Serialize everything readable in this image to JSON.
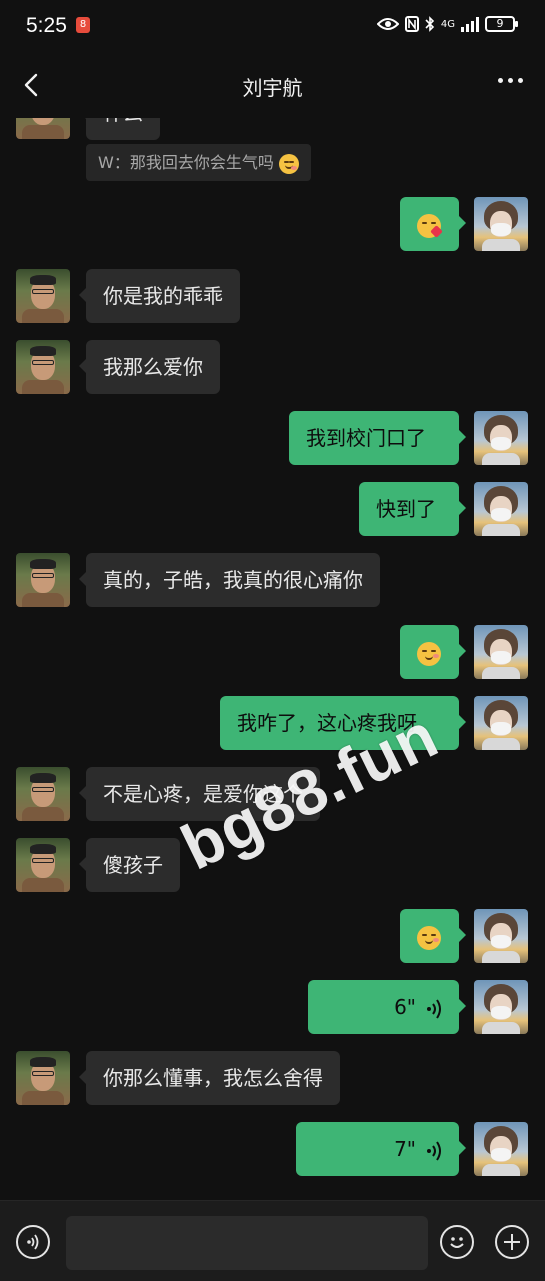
{
  "status": {
    "time": "5:25",
    "notif_badge": "8",
    "network": "4G",
    "battery": "9"
  },
  "header": {
    "title": "刘宇航"
  },
  "messages": [
    {
      "side": "left",
      "type": "text",
      "text": "什么"
    },
    {
      "side": "left",
      "type": "quote",
      "text": "W：那我回去你会生气吗"
    },
    {
      "side": "right",
      "type": "emoji",
      "emoji": "kissing-face"
    },
    {
      "side": "left",
      "type": "text",
      "text": "你是我的乖乖"
    },
    {
      "side": "left",
      "type": "text",
      "text": "我那么爱你"
    },
    {
      "side": "right",
      "type": "text",
      "text": "我到校门口了"
    },
    {
      "side": "right",
      "type": "text",
      "text": "快到了"
    },
    {
      "side": "left",
      "type": "text",
      "text": "真的，子皓，我真的很心痛你"
    },
    {
      "side": "right",
      "type": "emoji",
      "emoji": "shy-face"
    },
    {
      "side": "right",
      "type": "text",
      "text": "我咋了，这心疼我呀"
    },
    {
      "side": "left",
      "type": "text",
      "text": "不是心疼，是爱你这个"
    },
    {
      "side": "left",
      "type": "text",
      "text": "傻孩子"
    },
    {
      "side": "right",
      "type": "emoji",
      "emoji": "shy-face"
    },
    {
      "side": "right",
      "type": "voice",
      "text": "6\""
    },
    {
      "side": "left",
      "type": "text",
      "text": "你那么懂事，我怎么舍得"
    },
    {
      "side": "right",
      "type": "voice",
      "text": "7\""
    }
  ],
  "watermark": "bg88.fun",
  "input": {
    "placeholder": ""
  },
  "icons": {
    "back": "back-arrow-icon",
    "more": "more-dots-icon",
    "voice_toggle": "voice-mode-icon",
    "emoji": "emoji-icon",
    "add": "plus-icon"
  },
  "colors": {
    "background": "#111111",
    "self_bubble": "#3eb575",
    "other_bubble": "#2c2c2c"
  }
}
